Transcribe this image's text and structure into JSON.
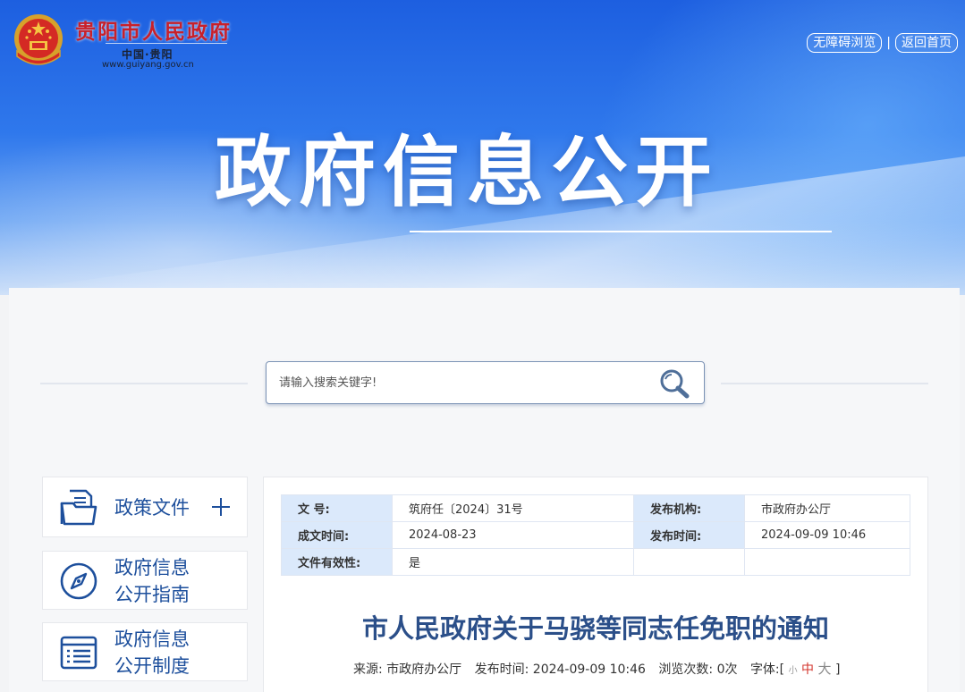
{
  "header": {
    "site_name": "贵阳市人民政府",
    "site_sub": "中国·贵阳",
    "site_url": "www.guiyang.gov.cn",
    "links": [
      {
        "label": "无障碍浏览"
      },
      {
        "label": "返回首页"
      }
    ],
    "separator": "|"
  },
  "hero": {
    "title": "政府信息公开"
  },
  "search": {
    "placeholder": "请输入搜索关键字!"
  },
  "sidebar": {
    "items": [
      {
        "label": "政策文件"
      },
      {
        "label_line1": "政府信息",
        "label_line2": "公开指南"
      },
      {
        "label_line1": "政府信息",
        "label_line2": "公开制度"
      }
    ]
  },
  "document": {
    "meta": {
      "doc_no_label": "文 号:",
      "doc_no": "筑府任〔2024〕31号",
      "issuer_label": "发布机构:",
      "issuer": "市政府办公厅",
      "created_label": "成文时间:",
      "created": "2024-08-23",
      "published_label": "发布时间:",
      "published": "2024-09-09 10:46",
      "validity_label": "文件有效性:",
      "validity": "是"
    },
    "title": "市人民政府关于马骁等同志任免职的通知",
    "info": {
      "source": "来源: 市政府办公厅",
      "publish_time": "发布时间: 2024-09-09 10:46",
      "views": "浏览次数: 0次",
      "font_label": "字体:[",
      "font_small": "小",
      "font_mid": "中",
      "font_big": "大",
      "font_close": "]"
    }
  },
  "colors": {
    "brand_red": "#c8202a",
    "link_blue": "#1d4f9c",
    "title_blue": "#2b4f89",
    "meta_key_bg": "#dbe9fb"
  }
}
